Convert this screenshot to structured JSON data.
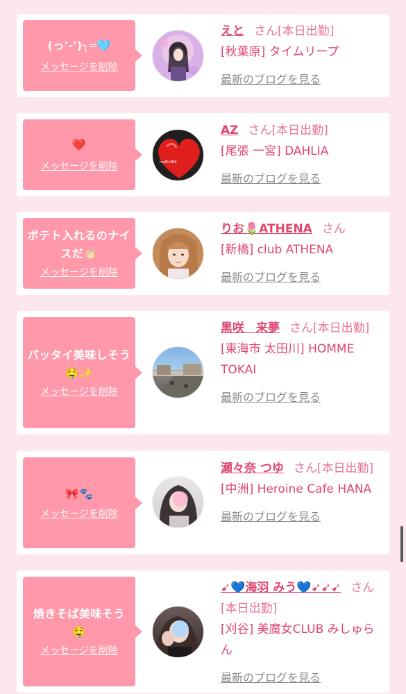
{
  "items": [
    {
      "message": "(っ'-')╮═🩵",
      "delete_label": "メッセージを削除",
      "cast_name": "えと",
      "suffix": "さん",
      "badge": "[本日出勤]",
      "shop": "[秋葉原] タイムリープ",
      "blog_label": "最新のブログを見る"
    },
    {
      "message": "❤️",
      "delete_label": "メッセージを削除",
      "cast_name": "AZ",
      "suffix": "さん",
      "badge": "[本日出勤]",
      "shop": "[尾張 一宮] DAHLIA",
      "blog_label": "最新のブログを見る"
    },
    {
      "message": "ポテト入れるのナイスだ👏🏻",
      "delete_label": "メッセージを削除",
      "cast_name": "りお🌷ATHENA",
      "suffix": "さん",
      "badge": "",
      "shop": "[新橋] club ATHENA",
      "blog_label": "最新のブログを見る"
    },
    {
      "message": "パッタイ美味しそう🤤✨",
      "delete_label": "メッセージを削除",
      "cast_name": "黒咲　来夢",
      "suffix": "さん",
      "badge": "[本日出勤]",
      "shop": "[東海市 太田川] HOMME TOKAI",
      "blog_label": "最新のブログを見る"
    },
    {
      "message": "🎀🐾",
      "delete_label": "メッセージを削除",
      "cast_name": "瀬々奈 つゆ",
      "suffix": "さん",
      "badge": "[本日出勤]",
      "shop": "[中洲] Heroine Cafe HANA",
      "blog_label": "最新のブログを見る"
    },
    {
      "message": "焼きそば美味そう🤤",
      "delete_label": "メッセージを削除",
      "cast_name": "➹💙海羽 みう💙➹➹➹",
      "suffix": "さん",
      "badge": "[本日出勤]",
      "shop": "[刈谷] 美魔女CLUB みしゅらん",
      "blog_label": "最新のブログを見る"
    }
  ],
  "colors": {
    "page_bg": "#fde7ee",
    "bubble": "#ff98aa",
    "accent": "#e0466e",
    "link_gray": "#888888"
  }
}
